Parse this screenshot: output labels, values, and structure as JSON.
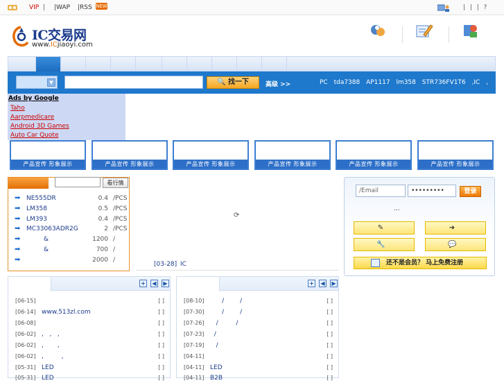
{
  "topbar": {
    "vip": "VIP",
    "sep": "|",
    "wap": "|WAP",
    "rss": "|RSS",
    "new_badge": "NEW",
    "links": "| | | ?"
  },
  "logo": {
    "brand": "IC交易网",
    "domain_prefix": "www.",
    "domain_hl": "IC",
    "domain_suffix": "jiaoyi.com"
  },
  "search": {
    "button": "找一下",
    "advanced": "高级 >>",
    "hot": "PC tda7388 AP1117 lm358 STR736FV1T6 ,IC ,"
  },
  "ads": {
    "title": "Ads by Google",
    "links": [
      "Taho",
      "Aarpmedicare",
      "Android 3D Games",
      "Auto Car Quote"
    ]
  },
  "promos": [
    "产品宣传 形象展示",
    "产品宣传 形象展示",
    "产品宣传 形象展示",
    "产品宣传 形象展示",
    "产品宣传 形象展示",
    "产品宣传 形象展示"
  ],
  "quotes": {
    "search_button": "看行情",
    "rows": [
      {
        "name": "NE555DR",
        "price": "0.4",
        "unit": "/PCS"
      },
      {
        "name": "LM358",
        "price": "0.5",
        "unit": "/PCS"
      },
      {
        "name": "LM393",
        "price": "0.4",
        "unit": "/PCS"
      },
      {
        "name": "MC33063ADR2G",
        "price": "2",
        "unit": "/PCS"
      },
      {
        "name": "&",
        "price": "1200",
        "unit": "/"
      },
      {
        "name": "&",
        "price": "700",
        "unit": "/"
      },
      {
        "name": "",
        "price": "2000",
        "unit": "/"
      }
    ]
  },
  "news": {
    "date": "[03-28]",
    "title": "IC"
  },
  "login": {
    "email_placeholder": "/Email",
    "password": "•••••••••",
    "login_button": "登录",
    "dots": "...",
    "register": "还不是会员？ 马上免费注册"
  },
  "list_left": [
    {
      "date": "[06-15]",
      "title": "",
      "b": "[ ]"
    },
    {
      "date": "[06-14]",
      "title": "www.513zl.com",
      "b": "[ ]"
    },
    {
      "date": "[06-08]",
      "title": "",
      "b": "[ ]"
    },
    {
      "date": "[06-02]",
      "title": ",   ,   ,",
      "b": "[ ]"
    },
    {
      "date": "[06-02]",
      "title": ",       ,",
      "b": "[ ]"
    },
    {
      "date": "[06-02]",
      "title": ",         ,",
      "b": "[ ]"
    },
    {
      "date": "[05-31]",
      "title": "LED",
      "b": "[ ]"
    },
    {
      "date": "[05-31]",
      "title": "LED",
      "b": "[ ]"
    }
  ],
  "list_right": [
    {
      "date": "[08-10]",
      "title": "      /        /",
      "b": "[ ]"
    },
    {
      "date": "[07-30]",
      "title": "      /        /",
      "b": "[ ]"
    },
    {
      "date": "[07-26]",
      "title": "   /         /",
      "b": "[ ]"
    },
    {
      "date": "[07-23]",
      "title": "  /",
      "b": "[ ]"
    },
    {
      "date": "[07-19]",
      "title": "   /",
      "b": "[ ]"
    },
    {
      "date": "[04-11]",
      "title": "",
      "b": "[ ]"
    },
    {
      "date": "[04-11]",
      "title": "LED",
      "b": "[ ]"
    },
    {
      "date": "[04-11]",
      "title": "B2B",
      "b": "[ ]"
    }
  ],
  "list_controls": [
    "+",
    "◀",
    "▶"
  ]
}
